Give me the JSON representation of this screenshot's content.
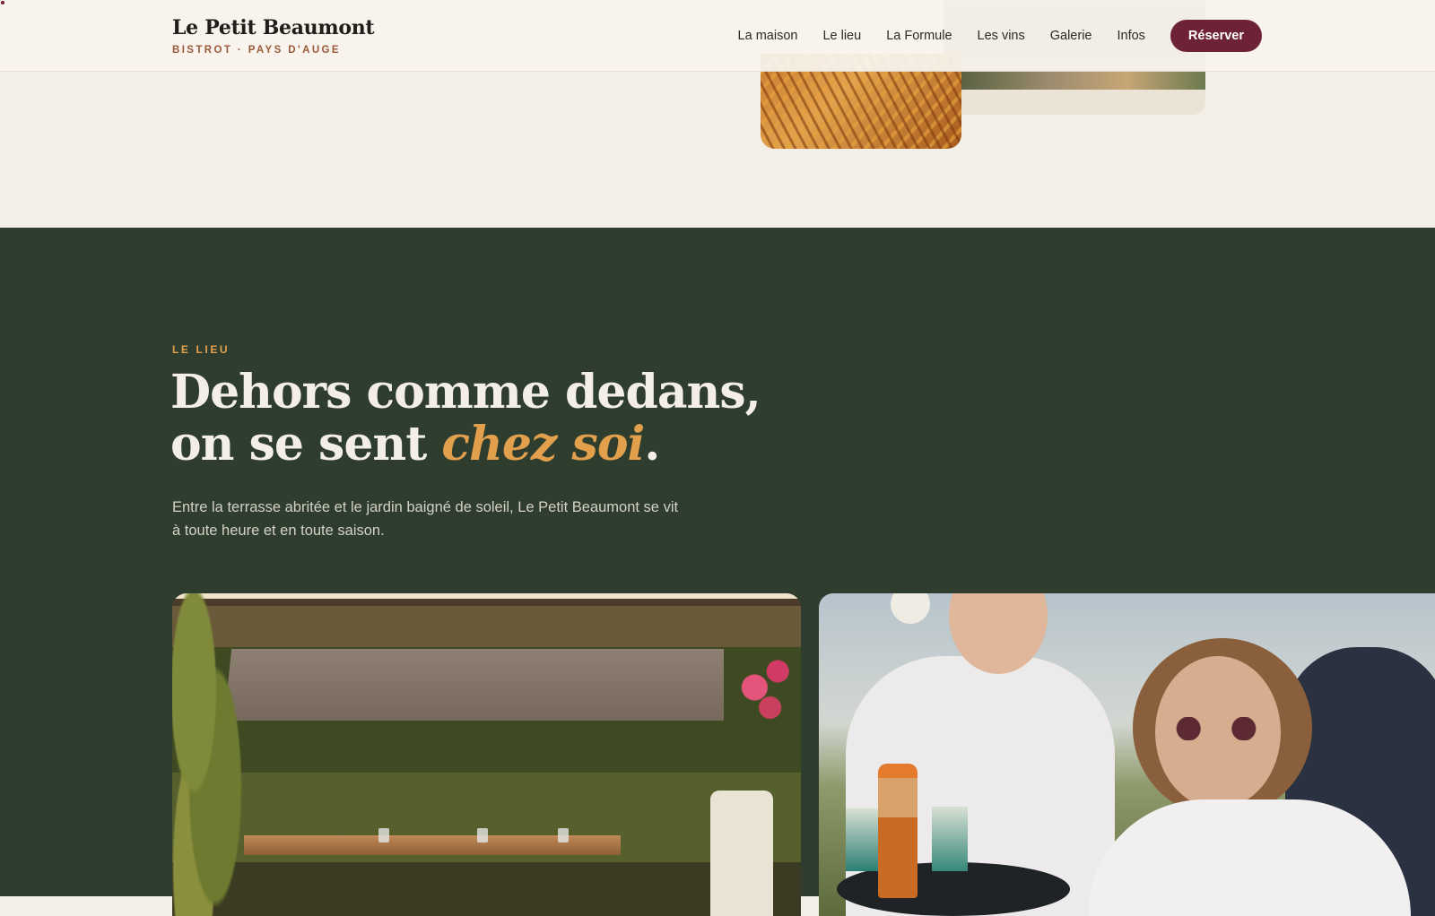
{
  "brand": {
    "title": "Le Petit Beaumont",
    "subtitle": "BISTROT · PAYS D'AUGE"
  },
  "nav": {
    "items": [
      {
        "label": "La maison"
      },
      {
        "label": "Le lieu"
      },
      {
        "label": "La Formule"
      },
      {
        "label": "Les vins"
      },
      {
        "label": "Galerie"
      },
      {
        "label": "Infos"
      }
    ],
    "cta_label": "Réserver"
  },
  "section_lieu": {
    "eyebrow": "LE LIEU",
    "headline_line1": "Dehors comme dedans,",
    "headline_line2_prefix": "on se sent ",
    "headline_accent": "chez soi",
    "headline_suffix": ".",
    "lead": "Entre la terrasse abritée et le jardin baigné de soleil, Le Petit Beaumont se vit à toute heure et en toute saison."
  },
  "colors": {
    "accent": "#e2a04c",
    "brand_burgundy": "#6e2238",
    "section_green": "#2f3d2f",
    "cream": "#f4efe6"
  }
}
